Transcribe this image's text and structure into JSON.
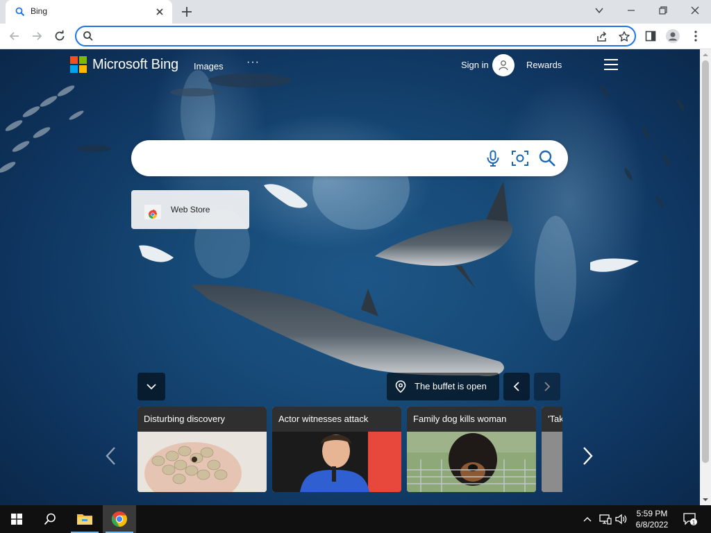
{
  "browser": {
    "tab": {
      "title": "Bing"
    },
    "omnibox": {
      "value": "",
      "placeholder": ""
    }
  },
  "bing": {
    "logo_text": "Microsoft Bing",
    "nav": {
      "images": "Images",
      "more": "···"
    },
    "sign_in": "Sign in",
    "rewards": "Rewards",
    "search": {
      "value": "",
      "placeholder": ""
    },
    "quick_link": {
      "label": "Web Store"
    },
    "location_text": "The buffet is open",
    "news": [
      {
        "title": "Disturbing discovery"
      },
      {
        "title": "Actor witnesses attack"
      },
      {
        "title": "Family dog kills woman"
      },
      {
        "title": "'Tak"
      }
    ]
  },
  "taskbar": {
    "time": "5:59 PM",
    "date": "6/8/2022",
    "notification_count": "1"
  }
}
